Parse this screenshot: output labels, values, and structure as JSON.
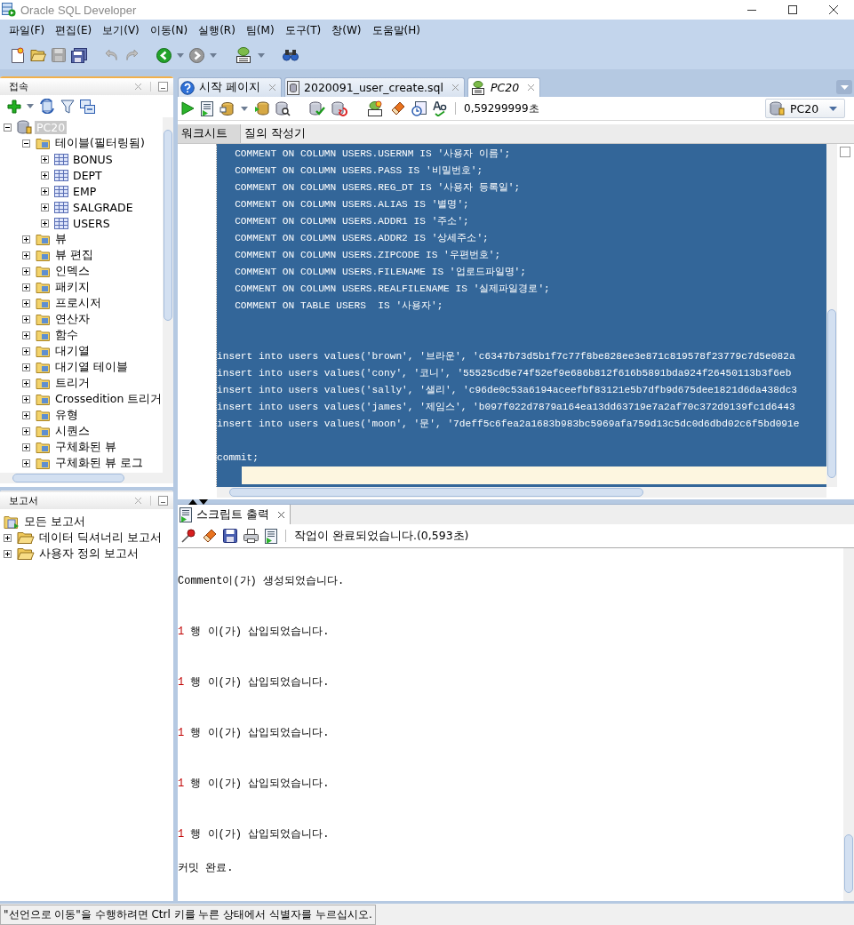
{
  "window": {
    "title": "Oracle SQL Developer"
  },
  "menu": [
    {
      "label": "파일(F)"
    },
    {
      "label": "편집(E)"
    },
    {
      "label": "보기(V)"
    },
    {
      "label": "이동(N)"
    },
    {
      "label": "실행(R)"
    },
    {
      "label": "팀(M)"
    },
    {
      "label": "도구(T)"
    },
    {
      "label": "창(W)"
    },
    {
      "label": "도움말(H)"
    }
  ],
  "connections_panel": {
    "title": "접속",
    "active": true,
    "tree": [
      {
        "label": "PC20",
        "kind": "connection",
        "expanded": true,
        "selected": true,
        "children": [
          {
            "label": "테이블(필터링됨)",
            "kind": "folder",
            "expanded": true,
            "selected": false,
            "children": [
              {
                "label": "BONUS",
                "kind": "table",
                "expanded": false,
                "selected": false
              },
              {
                "label": "DEPT",
                "kind": "table",
                "expanded": false,
                "selected": false
              },
              {
                "label": "EMP",
                "kind": "table",
                "expanded": false,
                "selected": false
              },
              {
                "label": "SALGRADE",
                "kind": "table",
                "expanded": false,
                "selected": false
              },
              {
                "label": "USERS",
                "kind": "table",
                "expanded": false,
                "selected": false
              }
            ]
          },
          {
            "label": "뷰",
            "kind": "folder",
            "expanded": false,
            "selected": false
          },
          {
            "label": "뷰 편집",
            "kind": "folder",
            "expanded": false,
            "selected": false
          },
          {
            "label": "인덱스",
            "kind": "folder",
            "expanded": false,
            "selected": false
          },
          {
            "label": "패키지",
            "kind": "folder",
            "expanded": false,
            "selected": false
          },
          {
            "label": "프로시저",
            "kind": "folder",
            "expanded": false,
            "selected": false
          },
          {
            "label": "연산자",
            "kind": "folder",
            "expanded": false,
            "selected": false
          },
          {
            "label": "함수",
            "kind": "folder",
            "expanded": false,
            "selected": false
          },
          {
            "label": "대기열",
            "kind": "folder",
            "expanded": false,
            "selected": false
          },
          {
            "label": "대기열 테이블",
            "kind": "folder",
            "expanded": false,
            "selected": false
          },
          {
            "label": "트리거",
            "kind": "folder",
            "expanded": false,
            "selected": false
          },
          {
            "label": "Crossedition 트리거",
            "kind": "folder",
            "expanded": false,
            "selected": false
          },
          {
            "label": "유형",
            "kind": "folder",
            "expanded": false,
            "selected": false
          },
          {
            "label": "시퀀스",
            "kind": "folder",
            "expanded": false,
            "selected": false
          },
          {
            "label": "구체화된 뷰",
            "kind": "folder",
            "expanded": false,
            "selected": false
          },
          {
            "label": "구체화된 뷰 로그",
            "kind": "folder",
            "expanded": false,
            "selected": false
          }
        ]
      }
    ]
  },
  "reports_panel": {
    "title": "보고서",
    "active": false,
    "tree": [
      {
        "label": "모든 보고서",
        "kind": "reports",
        "selected": false
      },
      {
        "label": "데이터 딕셔너리 보고서",
        "kind": "report_folder",
        "expanded": false,
        "selected": false
      },
      {
        "label": "사용자 정의 보고서",
        "kind": "report_folder",
        "expanded": false,
        "selected": false
      }
    ]
  },
  "editor": {
    "tabs": [
      {
        "label": "시작 페이지",
        "kind": "help",
        "selected": false
      },
      {
        "label": "2020091_user_create.sql",
        "kind": "file",
        "selected": false
      },
      {
        "label": "PC20",
        "kind": "worksheet",
        "selected": true
      }
    ],
    "elapsed": "0,59299999초",
    "connection": "PC20",
    "subtabs": [
      {
        "label": "워크시트",
        "selected": true
      },
      {
        "label": "질의 작성기",
        "selected": false
      }
    ],
    "lines": [
      {
        "kind": "code",
        "text": "   COMMENT ON COLUMN USERS.USERNM IS '사용자 이름';"
      },
      {
        "kind": "code",
        "text": "   COMMENT ON COLUMN USERS.PASS IS '비밀번호';"
      },
      {
        "kind": "code",
        "text": "   COMMENT ON COLUMN USERS.REG_DT IS '사용자 등록일';"
      },
      {
        "kind": "code",
        "text": "   COMMENT ON COLUMN USERS.ALIAS IS '별명';"
      },
      {
        "kind": "code",
        "text": "   COMMENT ON COLUMN USERS.ADDR1 IS '주소';"
      },
      {
        "kind": "code",
        "text": "   COMMENT ON COLUMN USERS.ADDR2 IS '상세주소';"
      },
      {
        "kind": "code",
        "text": "   COMMENT ON COLUMN USERS.ZIPCODE IS '우편번호';"
      },
      {
        "kind": "code",
        "text": "   COMMENT ON COLUMN USERS.FILENAME IS '업로드파일명';"
      },
      {
        "kind": "code",
        "text": "   COMMENT ON COLUMN USERS.REALFILENAME IS '실제파일경로';"
      },
      {
        "kind": "code",
        "text": "   COMMENT ON TABLE USERS  IS '사용자';"
      },
      {
        "kind": "blank"
      },
      {
        "kind": "blank"
      },
      {
        "kind": "code",
        "text": "insert into users values('brown', '브라운', 'c6347b73d5b1f7c77f8be828ee3e871c819578f23779c7d5e082a"
      },
      {
        "kind": "code",
        "text": "insert into users values('cony', '코니', '55525cd5e74f52ef9e686b812f616b5891bda924f26450113b3f6eb"
      },
      {
        "kind": "code",
        "text": "insert into users values('sally', '샐리', 'c96de0c53a6194aceefbf83121e5b7dfb9d675dee1821d6da438dc3"
      },
      {
        "kind": "code",
        "text": "insert into users values('james', '제임스', 'b097f022d7879a164ea13dd63719e7a2af70c372d9139fc1d6443"
      },
      {
        "kind": "code",
        "text": "insert into users values('moon', '문', '7deff5c6fea2a1683b983bc5969afa759d13c5dc0d6dbd02c6f5bd091e"
      },
      {
        "kind": "blank"
      },
      {
        "kind": "code",
        "text": "commit;"
      }
    ]
  },
  "output": {
    "tab": "스크립트 출력",
    "status": "작업이 완료되었습니다.(0,593초)",
    "lines": [
      {
        "kind": "blank"
      },
      {
        "kind": "message",
        "text": "Comment이(가) 생성되었습니다."
      },
      {
        "kind": "blank"
      },
      {
        "kind": "blank"
      },
      {
        "kind": "count",
        "count": "1",
        "text": "행 이(가) 삽입되었습니다."
      },
      {
        "kind": "blank"
      },
      {
        "kind": "blank"
      },
      {
        "kind": "count",
        "count": "1",
        "text": "행 이(가) 삽입되었습니다."
      },
      {
        "kind": "blank"
      },
      {
        "kind": "blank"
      },
      {
        "kind": "count",
        "count": "1",
        "text": "행 이(가) 삽입되었습니다."
      },
      {
        "kind": "blank"
      },
      {
        "kind": "blank"
      },
      {
        "kind": "count",
        "count": "1",
        "text": "행 이(가) 삽입되었습니다."
      },
      {
        "kind": "blank"
      },
      {
        "kind": "blank"
      },
      {
        "kind": "count",
        "count": "1",
        "text": "행 이(가) 삽입되었습니다."
      },
      {
        "kind": "blank"
      },
      {
        "kind": "message",
        "text": "커밋 완료."
      }
    ]
  },
  "status_bar": {
    "text": "\"선언으로 이동\"을 수행하려면 Ctrl 키를 누른 상태에서 식별자를 누르십시오."
  }
}
